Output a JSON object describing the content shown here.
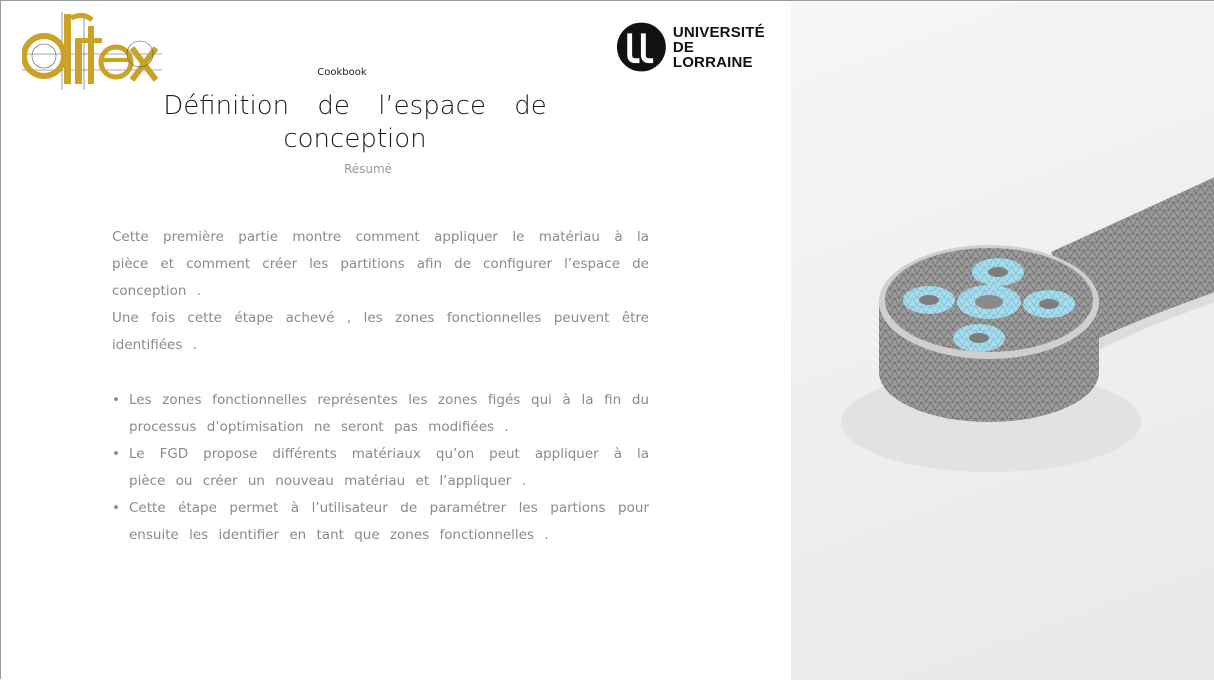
{
  "header": {
    "cookbook_label": "Cookbook",
    "title": "Définition de l’espace de conception",
    "subtitle": "Résumé",
    "university_line1": "UNIVERSITÉ",
    "university_line2": "DE LORRAINE"
  },
  "intro": {
    "paragraph1": "Cette première partie montre comment appliquer le matériau à la pièce et comment créer les partitions afin de configurer l’espace de conception .",
    "paragraph2": "Une fois cette étape achevé , les zones fonctionnelles peuvent être identifiées ."
  },
  "bullets": [
    "Les zones fonctionnelles représentes les zones figés qui à la fin du processus d’optimisation ne seront pas modifiées .",
    "Le FGD propose différents matériaux qu’on peut appliquer à la pièce ou créer un nouveau matériau et l’appliquer .",
    "Cette étape permet à l’utilisateur de paramétrer les partions pour ensuite les identifier en tant que zones fonctionnelles ."
  ],
  "bullet_symbol": "•",
  "colors": {
    "logo_gold": "#c9a227",
    "functional_zone": "#a9dcec",
    "mesh_gray": "#8f8f8f"
  }
}
